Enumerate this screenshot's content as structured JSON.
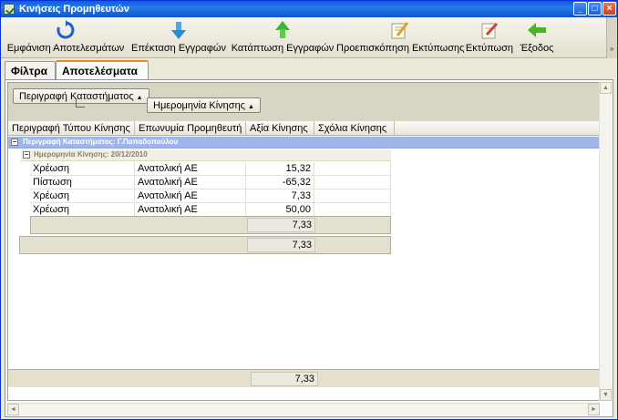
{
  "window": {
    "title": "Κινήσεις Προμηθευτών",
    "controls": [
      "_",
      "□",
      "×"
    ]
  },
  "toolbar": {
    "items": [
      {
        "label": "Εμφάνιση Αποτελεσμάτων",
        "icon": "refresh-icon"
      },
      {
        "label": "Επέκταση Εγγραφών",
        "icon": "arrow-down-icon"
      },
      {
        "label": "Κατάπτωση Εγγραφών",
        "icon": "arrow-up-icon"
      },
      {
        "label": "Προεπισκόπηση Εκτύπωσης",
        "icon": "print-preview-icon"
      },
      {
        "label": "Εκτύπωση",
        "icon": "print-icon"
      },
      {
        "label": "Έξοδος",
        "icon": "exit-arrow-icon"
      }
    ],
    "overflow": "»"
  },
  "tabs": [
    {
      "label": "Φίλτρα",
      "active": false
    },
    {
      "label": "Αποτελέσματα",
      "active": true
    }
  ],
  "group_panel": {
    "group1_label": "Περιγραφή Καταστήματος",
    "group2_label": "Ημερομηνία Κίνησης",
    "sort_arrow": "▲"
  },
  "columns": [
    "Περιγραφή Τύπου Κίνησης",
    "Επωνυμία Προμηθευτή",
    "Αξία Κίνησης",
    "Σχόλια Κίνησης"
  ],
  "group_row_1": "Περιγραφή Καταστήματος: Γ.Παπαδοπούλου",
  "group_row_2": "Ημερομηνία Κίνησης: 20/12/2010",
  "toggle_symbol": "−",
  "rows": [
    {
      "type": "Χρέωση",
      "supplier": "Ανατολική ΑΕ",
      "value": "15,32",
      "comment": ""
    },
    {
      "type": "Πίστωση",
      "supplier": "Ανατολική ΑΕ",
      "value": "-65,32",
      "comment": ""
    },
    {
      "type": "Χρέωση",
      "supplier": "Ανατολική ΑΕ",
      "value": "7,33",
      "comment": ""
    },
    {
      "type": "Χρέωση",
      "supplier": "Ανατολική ΑΕ",
      "value": "50,00",
      "comment": ""
    }
  ],
  "summaries": {
    "date_group_total": "7,33",
    "store_group_total": "7,33",
    "grand_total": "7,33"
  },
  "scroll": {
    "up": "▲",
    "down": "▼",
    "left": "◄",
    "right": "►"
  }
}
